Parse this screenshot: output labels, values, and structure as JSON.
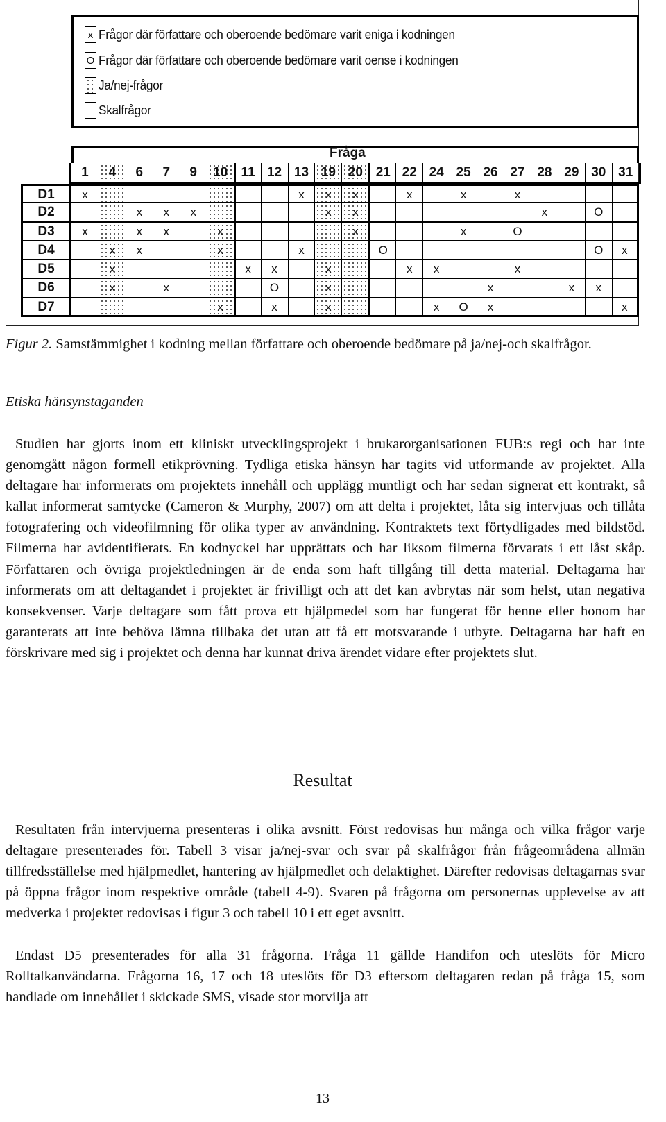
{
  "figure": {
    "legend": [
      {
        "symbol": "x",
        "swatch": "plain",
        "label": "Frågor där författare och oberoende bedömare varit eniga i kodningen"
      },
      {
        "symbol": "O",
        "swatch": "plain",
        "label": "Frågor där författare och oberoende bedömare varit oense i kodningen"
      },
      {
        "symbol": "",
        "swatch": "dotted",
        "label": "Ja/nej-frågor"
      },
      {
        "symbol": "",
        "swatch": "plain",
        "label": "Skalfrågor"
      }
    ],
    "table": {
      "header": "Fråga",
      "columns": [
        "1",
        "4",
        "6",
        "7",
        "9",
        "10",
        "11",
        "12",
        "13",
        "19",
        "20",
        "21",
        "22",
        "24",
        "25",
        "26",
        "27",
        "28",
        "29",
        "30",
        "31"
      ],
      "yes_no_columns": [
        "4",
        "10",
        "19",
        "20"
      ],
      "thick_border_before": [
        "11",
        "21"
      ],
      "rows": [
        {
          "label": "D1",
          "cells": [
            "x",
            "",
            "",
            "",
            "",
            "",
            "",
            "",
            "x",
            "x",
            "x",
            "",
            "x",
            "",
            "x",
            "",
            "x",
            "",
            "",
            "",
            ""
          ]
        },
        {
          "label": "D2",
          "cells": [
            "",
            "",
            "x",
            "x",
            "x",
            "",
            "",
            "",
            "",
            "x",
            "x",
            "",
            "",
            "",
            "",
            "",
            "",
            "x",
            "",
            "O",
            ""
          ]
        },
        {
          "label": "D3",
          "cells": [
            "x",
            "",
            "x",
            "x",
            "",
            "x",
            "",
            "",
            "",
            "",
            "x",
            "",
            "",
            "",
            "x",
            "",
            "O",
            "",
            "",
            "",
            ""
          ]
        },
        {
          "label": "D4",
          "cells": [
            "",
            "x",
            "x",
            "",
            "",
            "x",
            "",
            "",
            "x",
            "",
            "",
            "O",
            "",
            "",
            "",
            "",
            "",
            "",
            "",
            "O",
            "x"
          ]
        },
        {
          "label": "D5",
          "cells": [
            "",
            "x",
            "",
            "",
            "",
            "",
            "x",
            "x",
            "",
            "x",
            "",
            "",
            "x",
            "x",
            "",
            "",
            "x",
            "",
            "",
            "",
            ""
          ]
        },
        {
          "label": "D6",
          "cells": [
            "",
            "x",
            "",
            "x",
            "",
            "",
            "",
            "O",
            "",
            "x",
            "",
            "",
            "",
            "",
            "",
            "x",
            "",
            "",
            "x",
            "x",
            ""
          ]
        },
        {
          "label": "D7",
          "cells": [
            "",
            "",
            "",
            "",
            "",
            "x",
            "",
            "x",
            "",
            "x",
            "",
            "",
            "",
            "x",
            "O",
            "x",
            "",
            "",
            "",
            "",
            "x"
          ]
        }
      ]
    },
    "caption_label": "Figur 2.",
    "caption_text": " Samstämmighet i kodning mellan författare och oberoende bedömare på ja/nej-och skalfrågor."
  },
  "section_ethics": {
    "heading": "Etiska hänsynstaganden",
    "paragraph": "Studien har gjorts inom ett kliniskt utvecklingsprojekt i brukarorganisationen FUB:s regi och har inte genomgått någon formell etikprövning. Tydliga etiska hänsyn har tagits vid utformande av projektet. Alla deltagare har informerats om projektets innehåll och upplägg muntligt och har sedan signerat ett kontrakt, så kallat informerat samtycke (Cameron & Murphy, 2007) om att delta i projektet, låta sig intervjuas och tillåta fotografering och videofilmning för olika typer av användning. Kontraktets text förtydligades med bildstöd. Filmerna har avidentifierats. En kodnyckel har upprättats och har liksom filmerna förvarats i ett låst skåp. Författaren och övriga projektledningen är de enda som haft tillgång till detta material. Deltagarna har informerats om att deltagandet i projektet är frivilligt och att det kan avbrytas när som helst, utan negativa konsekvenser. Varje deltagare som fått prova ett hjälpmedel som har fungerat för henne eller honom har garanterats att inte behöva lämna tillbaka det utan att få ett motsvarande i utbyte. Deltagarna har haft en förskrivare med sig i projektet och denna har kunnat driva ärendet vidare efter projektets slut."
  },
  "section_results": {
    "heading": "Resultat",
    "paragraphs": [
      "Resultaten från intervjuerna presenteras i olika avsnitt. Först redovisas hur många och vilka frågor varje deltagare presenterades för. Tabell 3 visar ja/nej-svar och svar på skalfrågor från frågeområdena allmän tillfredsställelse med hjälpmedlet, hantering av hjälpmedlet och delaktighet. Därefter redovisas deltagarnas svar på öppna frågor inom respektive område (tabell 4-9). Svaren på frågorna om personernas upplevelse av att medverka i projektet redovisas i figur 3 och tabell 10 i ett eget avsnitt.",
      "Endast D5 presenterades för alla 31 frågorna. Fråga 11 gällde Handifon och uteslöts för Micro Rolltalkanvändarna. Frågorna 16, 17 och 18 uteslöts för D3 eftersom deltagaren redan på fråga 15, som handlade om innehållet i skickade SMS, visade stor motvilja att"
    ]
  },
  "page_number": "13"
}
